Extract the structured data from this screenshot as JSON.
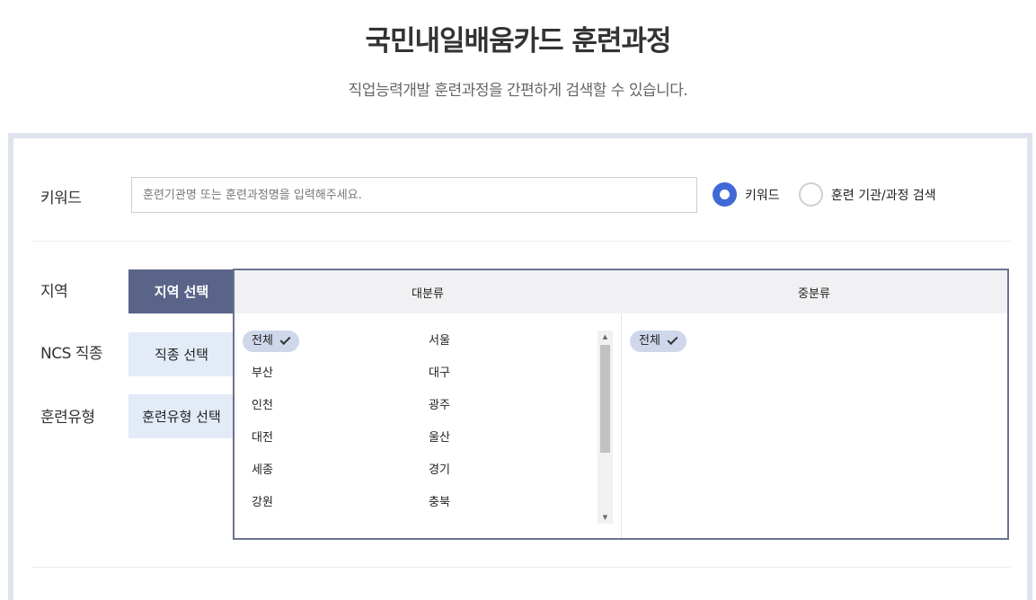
{
  "header": {
    "title": "국민내일배움카드 훈련과정",
    "subtitle": "직업능력개발 훈련과정을 간편하게 검색할 수 있습니다."
  },
  "keyword_row": {
    "label": "키워드",
    "input_placeholder": "훈련기관명 또는 훈련과정명을 입력해주세요.",
    "input_value": "",
    "radios": [
      {
        "label": "키워드",
        "checked": true
      },
      {
        "label": "훈련 기관/과정 검색",
        "checked": false
      }
    ]
  },
  "filters": {
    "region_label": "지역",
    "ncs_label": "NCS 직종",
    "training_type_label": "훈련유형",
    "tabs": [
      {
        "label": "지역 선택",
        "active": true
      },
      {
        "label": "직종 선택",
        "active": false
      },
      {
        "label": "훈련유형 선택",
        "active": false
      }
    ]
  },
  "category": {
    "major_header": "대분류",
    "minor_header": "중분류",
    "major_items": [
      "전체",
      "서울",
      "부산",
      "대구",
      "인천",
      "광주",
      "대전",
      "울산",
      "세종",
      "경기",
      "강원",
      "충북"
    ],
    "selected_major": "전체",
    "minor_items": [
      "전체"
    ],
    "selected_minor": "전체"
  },
  "colors": {
    "accent": "#4169d6",
    "tab_active": "#5a6488",
    "tab_inactive": "#e3ebf7",
    "chip": "#cfd7ea",
    "panel_border": "#dfe3ee"
  }
}
